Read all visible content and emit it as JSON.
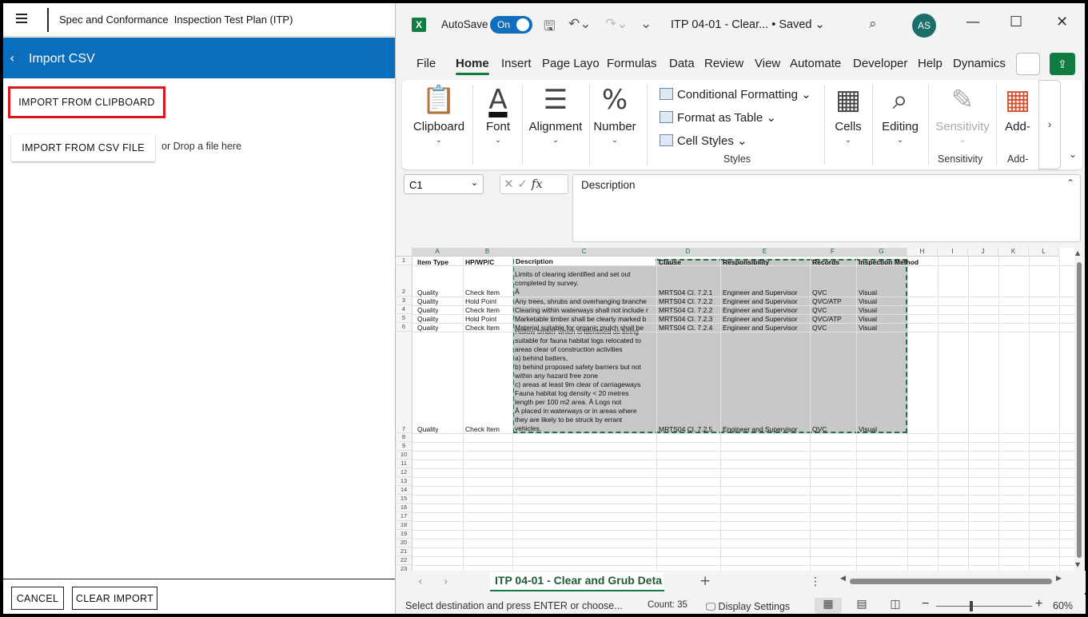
{
  "left_panel": {
    "app_title": "Spec and Conformance  Inspection Test Plan (ITP)",
    "page_title": "Import CSV",
    "import_clipboard": "IMPORT FROM CLIPBOARD",
    "import_csv": "IMPORT FROM CSV FILE",
    "drop_hint": "or Drop a file here",
    "cancel": "CANCEL",
    "clear_import": "CLEAR IMPORT"
  },
  "excel": {
    "logo": "X",
    "autosave_label": "AutoSave",
    "autosave_state": "On",
    "doc_title": "ITP 04-01 - Clear... • Saved ⌄",
    "user_initials": "AS",
    "menu_tabs": [
      "File",
      "Home",
      "Insert",
      "Page Layo",
      "Formulas",
      "Data",
      "Review",
      "View",
      "Automate",
      "Developer",
      "Help",
      "Dynamics"
    ],
    "active_tab": "Home",
    "ribbon": {
      "clipboard": "Clipboard",
      "font": "Font",
      "alignment": "Alignment",
      "number": "Number",
      "conditional_formatting": "Conditional Formatting ⌄",
      "format_as_table": "Format as Table ⌄",
      "cell_styles": "Cell Styles ⌄",
      "styles_group": "Styles",
      "cells": "Cells",
      "editing": "Editing",
      "sensitivity": "Sensitivity",
      "sensitivity_group": "Sensitivity",
      "addins": "Add-",
      "addins_group": "Add-"
    },
    "name_box": "C1",
    "formula_content": "Description",
    "columns": [
      "A",
      "B",
      "C",
      "D",
      "E",
      "F",
      "G",
      "H",
      "I",
      "J",
      "K",
      "L"
    ],
    "headers": {
      "a": "Item Type",
      "b": "HP/WP/C",
      "c": "Description",
      "d": "Clause",
      "e": "Responsibility",
      "f": "Records",
      "g": "Inspection Method"
    },
    "row2_desc_lines": [
      "Limits of clearing identified and set out",
      "completed by survey.",
      "Â"
    ],
    "rows": [
      {
        "num": "2",
        "a": "Quality",
        "b": "Check Item",
        "c": "",
        "d": "MRTS04 Cl. 7.2.1",
        "e": "Engineer and Supervisor",
        "f": "QVC",
        "g": "Visual"
      },
      {
        "num": "3",
        "a": "Quality",
        "b": "Hold Point",
        "c": "Any trees, shrubs and overhanging branche",
        "d": "MRTS04 Cl. 7.2.2",
        "e": "Engineer and Supervisor",
        "f": "QVC/ATP",
        "g": "Visual"
      },
      {
        "num": "4",
        "a": "Quality",
        "b": "Check Item",
        "c": "Clearing within waterways shall not include r",
        "d": "MRTS04 Cl. 7.2.2",
        "e": "Engineer and Supervisor",
        "f": "QVC",
        "g": "Visual"
      },
      {
        "num": "5",
        "a": "Quality",
        "b": "Hold Point",
        "c": "Marketable timber shall be clearly marked b",
        "d": "MRTS04 Cl. 7.2.3",
        "e": "Engineer and Supervisor",
        "f": "QVC/ATP",
        "g": "Visual"
      },
      {
        "num": "6",
        "a": "Quality",
        "b": "Check Item",
        "c": "Material suitable for organic mulch shall be",
        "d": "MRTS04 Cl. 7.2.4",
        "e": "Engineer and Supervisor",
        "f": "QVC",
        "g": "Visual"
      }
    ],
    "row7_desc_lines": [
      "Hollow timber which is identified as being",
      "suitable for fauna habitat logs relocated to",
      "areas clear of construction activities",
      "a) behind batters,",
      "b) behind proposed safety barriers but not",
      "within any hazard free zone",
      "c) areas at least 9m clear of carriageways",
      "Fauna habitat log density < 20 metres",
      "length per 100 m2 area. Â Logs not",
      "Â placed in waterways or in areas where",
      "they are likely to be struck by errant",
      "vehicles."
    ],
    "row7": {
      "num": "7",
      "a": "Quality",
      "b": "Check Item",
      "d": "MRTS04 Cl. 7.2.5",
      "e": "Engineer and Supervisor",
      "f": "QVC",
      "g": "Visual"
    },
    "empty_rows": [
      "8",
      "9",
      "10",
      "11",
      "12",
      "13",
      "14",
      "15",
      "16",
      "17",
      "18",
      "19",
      "20",
      "21",
      "22",
      "23"
    ],
    "row1_num": "1",
    "sheet_tab": "ITP 04-01 - Clear and Grub Deta",
    "status_text": "Select destination and press ENTER or choose...",
    "count_text": "Count: 35",
    "display_settings": "Display Settings",
    "zoom_level": "60%",
    "zoom_fraction": 0.35
  }
}
